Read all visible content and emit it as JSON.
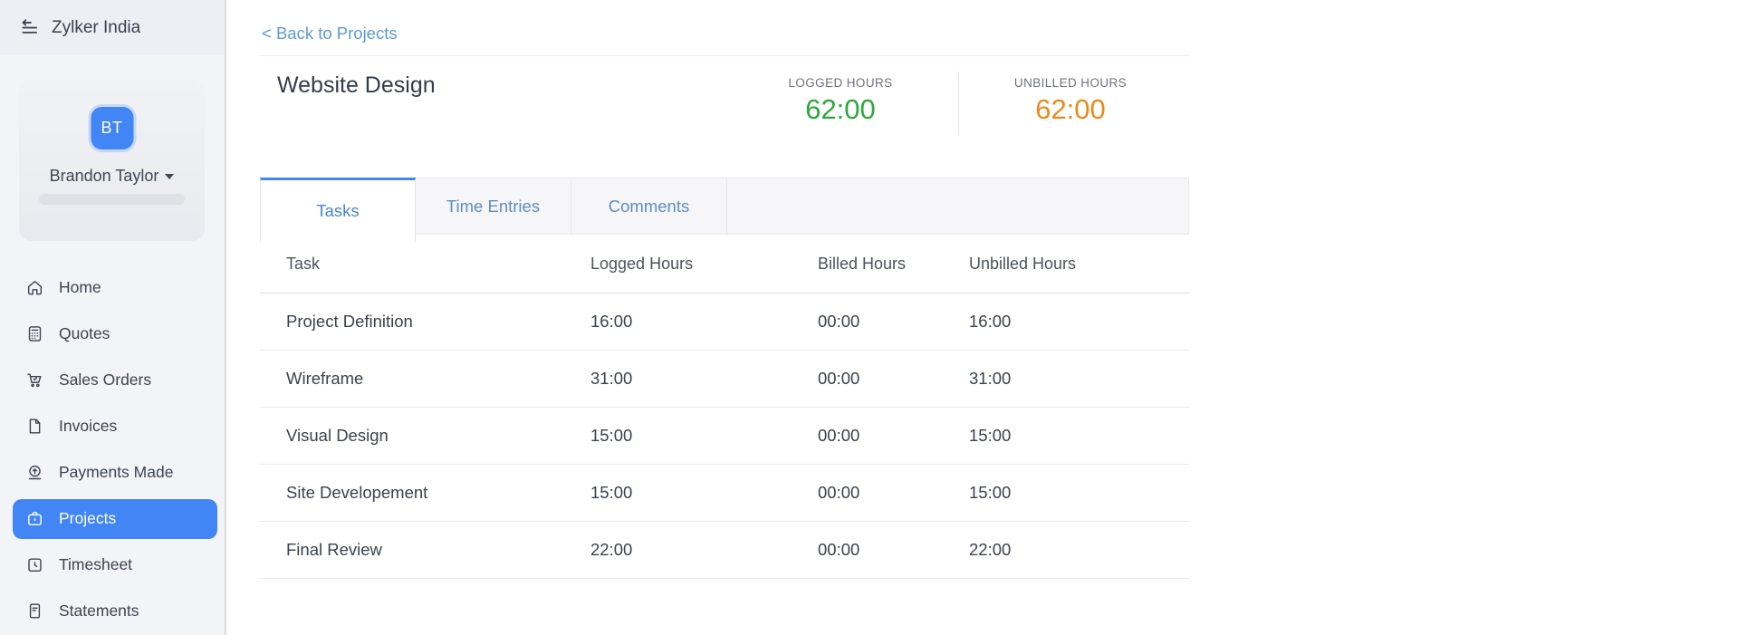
{
  "colors": {
    "accent_blue": "#4285f4",
    "link_blue": "#5b9bd6",
    "logged_green": "#2ea83c",
    "unbilled_orange": "#ea8a1b"
  },
  "topbar": {
    "company": "Zylker India"
  },
  "sidebar": {
    "user": {
      "initials": "BT",
      "name": "Brandon Taylor"
    },
    "items": [
      {
        "label": "Home",
        "icon": "home-icon",
        "active": false
      },
      {
        "label": "Quotes",
        "icon": "quotes-icon",
        "active": false
      },
      {
        "label": "Sales Orders",
        "icon": "sales-orders-icon",
        "active": false
      },
      {
        "label": "Invoices",
        "icon": "invoices-icon",
        "active": false
      },
      {
        "label": "Payments Made",
        "icon": "payments-made-icon",
        "active": false
      },
      {
        "label": "Projects",
        "icon": "projects-icon",
        "active": true
      },
      {
        "label": "Timesheet",
        "icon": "timesheet-icon",
        "active": false
      },
      {
        "label": "Statements",
        "icon": "statements-icon",
        "active": false
      }
    ]
  },
  "main": {
    "back_link": "< Back to Projects",
    "project": {
      "title": "Website Design"
    },
    "metrics": [
      {
        "label": "LOGGED HOURS",
        "value": "62:00",
        "color": "#2ea83c"
      },
      {
        "label": "UNBILLED HOURS",
        "value": "62:00",
        "color": "#ea8a1b"
      }
    ],
    "tabs": [
      {
        "label": "Tasks",
        "active": true
      },
      {
        "label": "Time Entries",
        "active": false
      },
      {
        "label": "Comments",
        "active": false
      }
    ],
    "table": {
      "columns": [
        "Task",
        "Logged Hours",
        "Billed Hours",
        "Unbilled Hours"
      ],
      "rows": [
        {
          "task": "Project Definition",
          "logged": "16:00",
          "billed": "00:00",
          "unbilled": "16:00"
        },
        {
          "task": "Wireframe",
          "logged": "31:00",
          "billed": "00:00",
          "unbilled": "31:00"
        },
        {
          "task": "Visual Design",
          "logged": "15:00",
          "billed": "00:00",
          "unbilled": "15:00"
        },
        {
          "task": "Site Developement",
          "logged": "15:00",
          "billed": "00:00",
          "unbilled": "15:00"
        },
        {
          "task": "Final Review",
          "logged": "22:00",
          "billed": "00:00",
          "unbilled": "22:00"
        }
      ]
    }
  }
}
